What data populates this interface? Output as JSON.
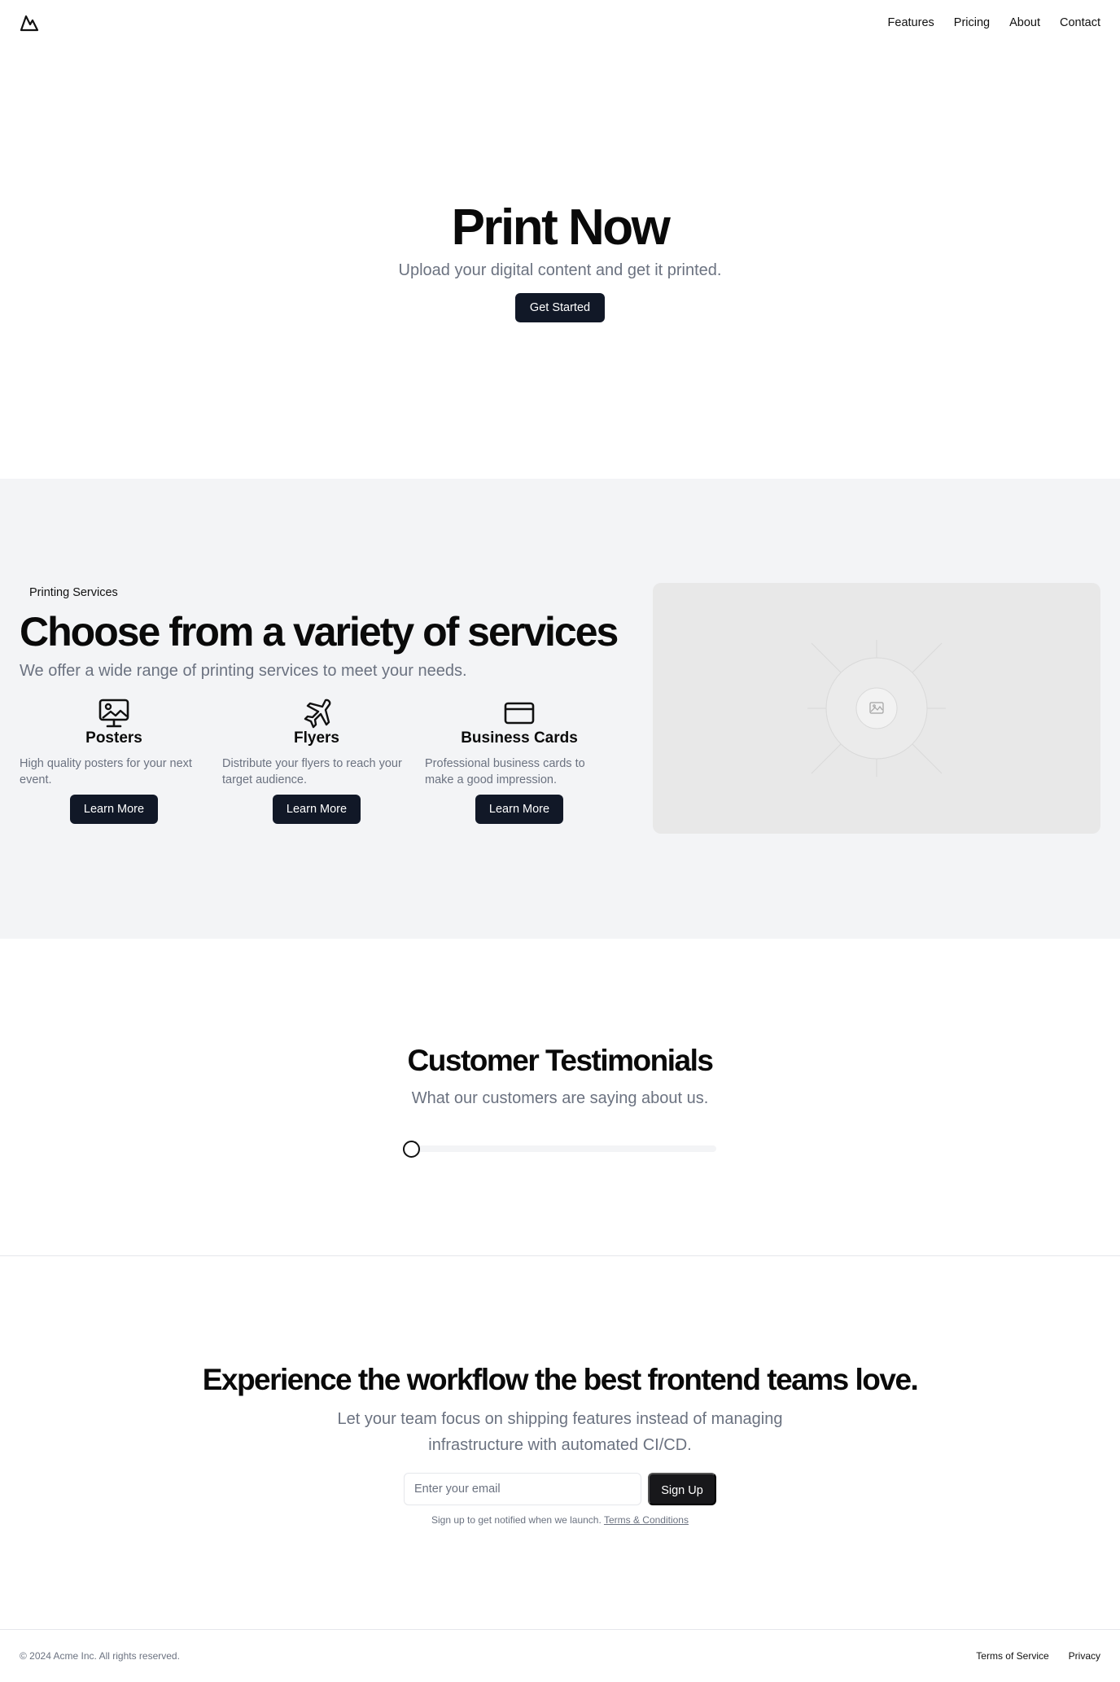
{
  "header": {
    "logo": "mountain-icon",
    "nav": [
      "Features",
      "Pricing",
      "About",
      "Contact"
    ]
  },
  "hero": {
    "title": "Print Now",
    "subtitle": "Upload your digital content and get it printed.",
    "cta": "Get Started"
  },
  "services": {
    "label": "Printing Services",
    "title": "Choose from a variety of services",
    "subtitle": "We offer a wide range of printing services to meet your needs.",
    "cards": [
      {
        "icon": "image-monitor-icon",
        "title": "Posters",
        "desc": "High quality posters for your next event.",
        "button": "Learn More"
      },
      {
        "icon": "plane-icon",
        "title": "Flyers",
        "desc": "Distribute your flyers to reach your target audience.",
        "button": "Learn More"
      },
      {
        "icon": "credit-card-icon",
        "title": "Business Cards",
        "desc": "Professional business cards to make a good impression.",
        "button": "Learn More"
      }
    ],
    "image": "placeholder-image"
  },
  "testimonials": {
    "title": "Customer Testimonials",
    "subtitle": "What our customers are saying about us.",
    "slider_value": 0
  },
  "cta": {
    "title": "Experience the workflow the best frontend teams love.",
    "subtitle": "Let your team focus on shipping features instead of managing infrastructure with automated CI/CD.",
    "email_placeholder": "Enter your email",
    "button": "Sign Up",
    "fine_print": "Sign up to get notified when we launch.",
    "terms_link": "Terms & Conditions"
  },
  "footer": {
    "copyright": "© 2024 Acme Inc. All rights reserved.",
    "links": [
      "Terms of Service",
      "Privacy"
    ]
  },
  "colors": {
    "primary_button": "#111827",
    "signup_button": "#18181b",
    "muted_text": "#6b7280",
    "section_bg": "#f3f4f6",
    "placeholder_bg": "#e8e8e8"
  }
}
